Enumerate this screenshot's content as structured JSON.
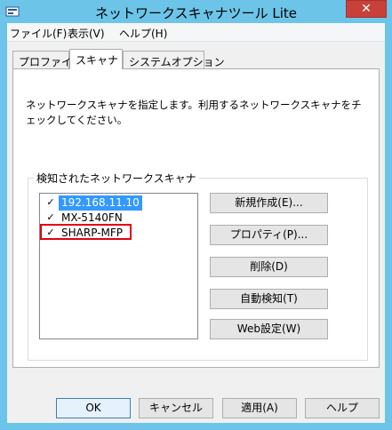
{
  "window": {
    "title": "ネットワークスキャナツール Lite",
    "close_glyph": "✕"
  },
  "menu": [
    "ファイル(F)",
    "表示(V)",
    "ヘルプ(H)"
  ],
  "tabs": [
    {
      "label": "プロファイル",
      "active": false
    },
    {
      "label": "スキャナ",
      "active": true
    },
    {
      "label": "システムオプション",
      "active": false
    }
  ],
  "panel": {
    "description": "ネットワークスキャナを指定します。利用するネットワークスキャナをチェックしてください。",
    "group_label": "検知されたネットワークスキャナ",
    "scanners": [
      {
        "label": "192.168.11.10",
        "checked": true,
        "selected": true
      },
      {
        "label": "MX-5140FN",
        "checked": true,
        "selected": false
      },
      {
        "label": "SHARP-MFP",
        "checked": true,
        "selected": false
      }
    ],
    "check_glyph": "✓",
    "side_buttons": [
      "新規作成(E)...",
      "プロパティ(P)...",
      "削除(D)",
      "自動検知(T)",
      "Web設定(W)"
    ]
  },
  "footer_buttons": [
    "OK",
    "キャンセル",
    "適用(A)",
    "ヘルプ"
  ],
  "colors": {
    "selection": "#3399ff",
    "highlight_box": "#e3000f",
    "close_button": "#c7413a"
  }
}
